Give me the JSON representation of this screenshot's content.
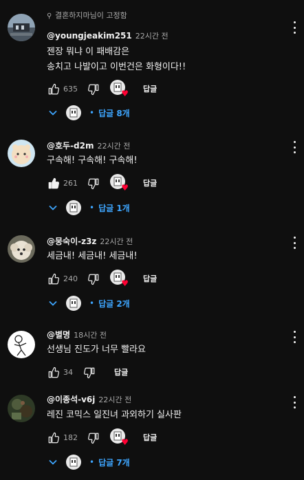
{
  "pinned_label": "결혼하지마님이 고정함",
  "actions": {
    "reply_label": "답글"
  },
  "comments": [
    {
      "author": "@youngjeakim251",
      "time": "22시간 전",
      "line1": "젠장 뭐냐 이 패배감은",
      "line2": "송치고 나발이고 이번건은 화형이다!!",
      "likes": "635",
      "liked": false,
      "hearted": true,
      "replies_label": "답글 8개"
    },
    {
      "author": "@호두-d2m",
      "time": "22시간 전",
      "line1": "구속해!  구속해!  구속해!",
      "likes": "261",
      "liked": true,
      "hearted": true,
      "replies_label": "답글 1개"
    },
    {
      "author": "@뭉숙이-z3z",
      "time": "22시간 전",
      "line1": "세금내! 세금내! 세금내!",
      "likes": "240",
      "liked": false,
      "hearted": true,
      "replies_label": "답글 2개"
    },
    {
      "author": "@별명",
      "time": "18시간 전",
      "line1": "선생님 진도가 너무 빨라요",
      "likes": "34",
      "liked": false,
      "hearted": false
    },
    {
      "author": "@이종석-v6j",
      "time": "22시간 전",
      "line1": "레진 코믹스 일진녀 과외하기 실사판",
      "likes": "182",
      "liked": false,
      "hearted": true,
      "replies_label": "답글 7개"
    }
  ],
  "colors": {
    "background": "#0f0f0f",
    "link": "#3ea6ff",
    "heart": "#ff0033",
    "muted": "#aaaaaa"
  },
  "icons": [
    "pin-icon",
    "thumbs-up-icon",
    "thumbs-down-icon",
    "heart-icon",
    "chevron-down-icon",
    "more-vert-icon"
  ]
}
